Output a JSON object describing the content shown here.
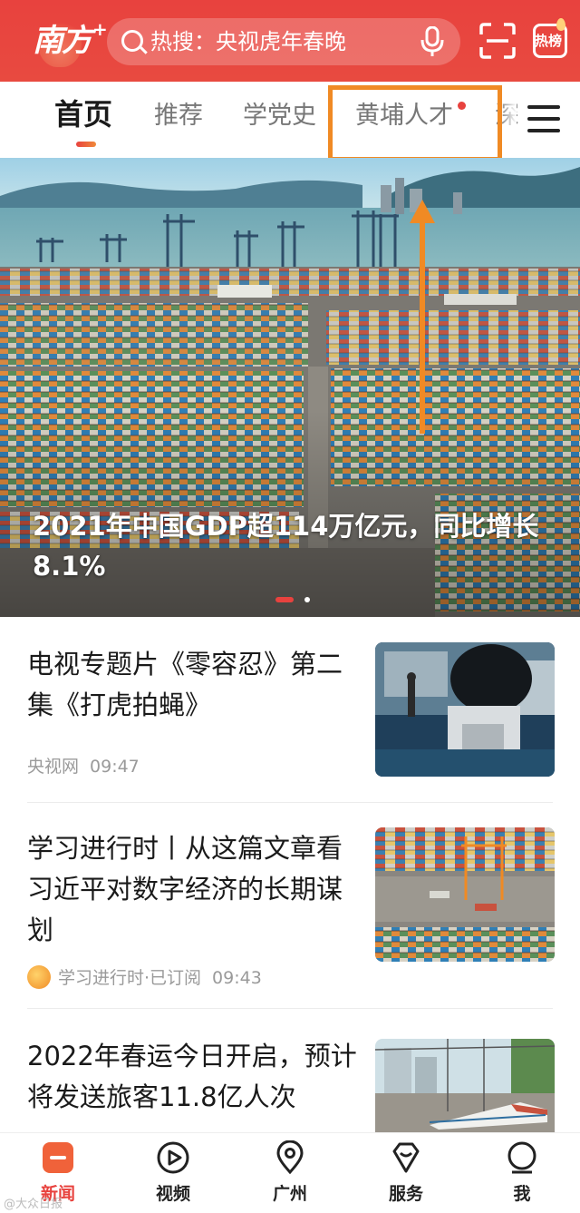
{
  "header": {
    "logo_text": "南方",
    "logo_plus": "+",
    "search_text": "热搜：央视虎年春晚",
    "hot_label": "热榜"
  },
  "tabs": [
    {
      "label": "首页",
      "active": true
    },
    {
      "label": "推荐"
    },
    {
      "label": "学党史"
    },
    {
      "label": "黄埔人才",
      "badge_dot": true
    },
    {
      "label": "深"
    }
  ],
  "hero": {
    "title": "2021年中国GDP超114万亿元，同比增长8.1%"
  },
  "feed": [
    {
      "title": "电视专题片《零容忍》第二集《打虎拍蝇》",
      "source": "央视网",
      "time": "09:47"
    },
    {
      "title": "学习进行时丨从这篇文章看习近平对数字经济的长期谋划",
      "source": "学习进行时·已订阅",
      "time": "09:43"
    },
    {
      "title": "2022年春运今日开启，预计将发送旅客11.8亿人次"
    }
  ],
  "bottom_nav": [
    {
      "label": "新闻",
      "icon": "news-icon",
      "active": true
    },
    {
      "label": "视频",
      "icon": "video-icon"
    },
    {
      "label": "广州",
      "icon": "location-pin-icon"
    },
    {
      "label": "服务",
      "icon": "service-icon"
    },
    {
      "label": "我",
      "icon": "profile-icon"
    }
  ],
  "colors": {
    "brand": "#e8423e",
    "annotation": "#f08a24"
  },
  "watermark": "@大众日报"
}
